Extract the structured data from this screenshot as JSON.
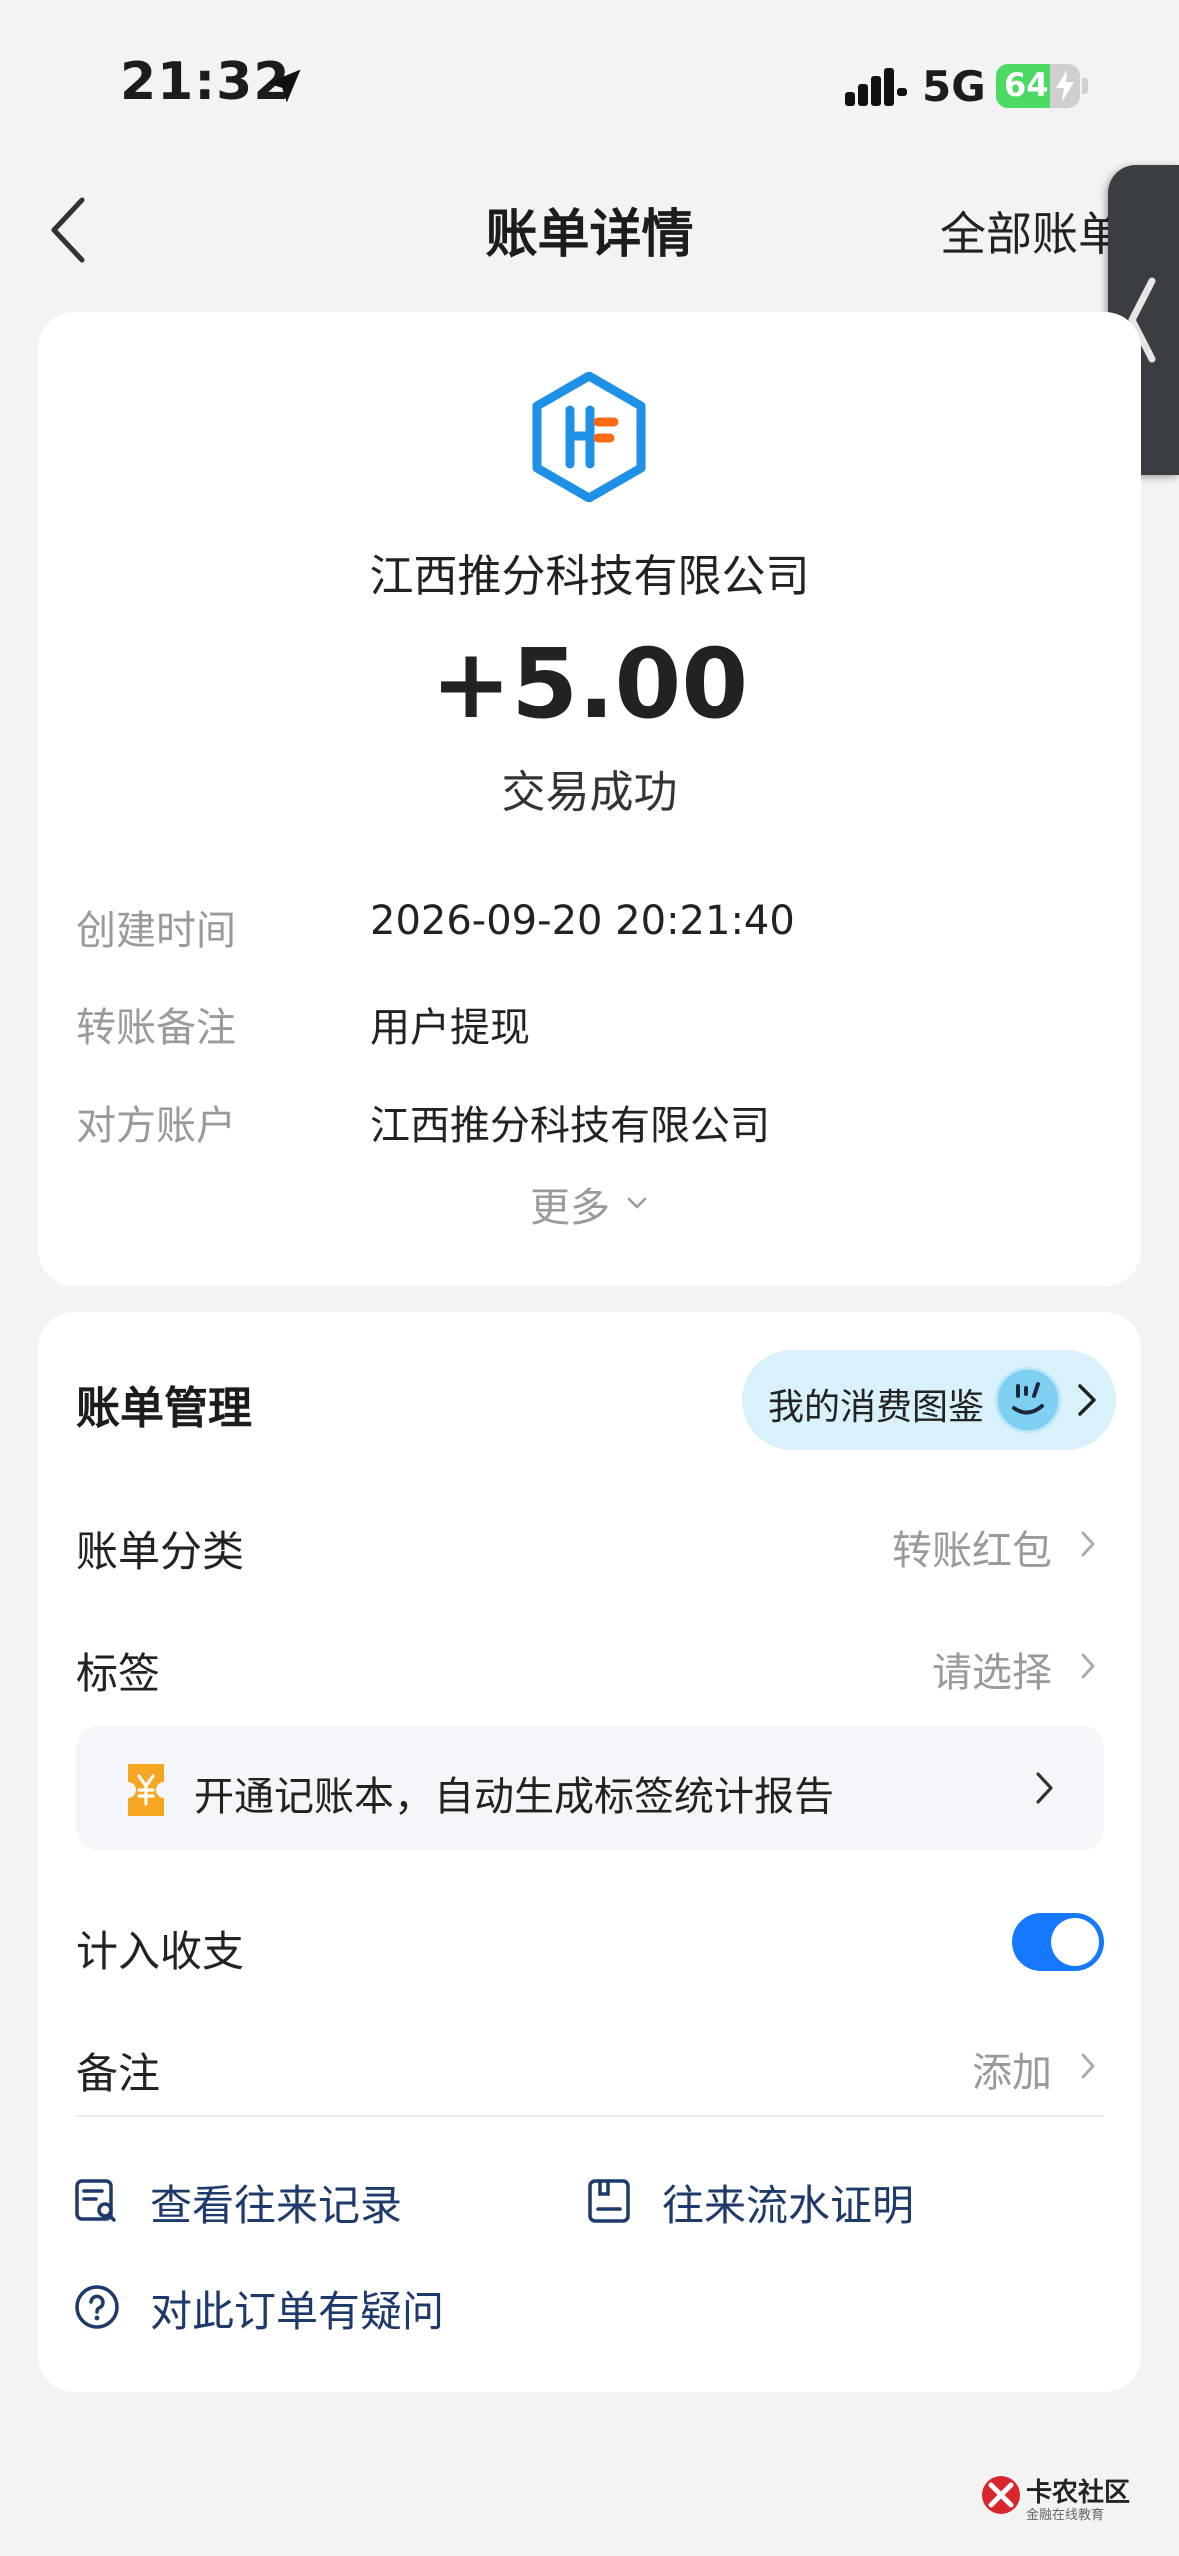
{
  "status_bar": {
    "time": "21:32",
    "network": "5G",
    "battery": "64"
  },
  "nav": {
    "title": "账单详情",
    "right": "全部账单"
  },
  "bill": {
    "merchant": "江西推分科技有限公司",
    "amount": "+5.00",
    "status": "交易成功",
    "details": [
      {
        "label": "创建时间",
        "value": "2026-09-20 20:21:40"
      },
      {
        "label": "转账备注",
        "value": "用户提现"
      },
      {
        "label": "对方账户",
        "value": "江西推分科技有限公司"
      }
    ],
    "more": "更多"
  },
  "management": {
    "title": "账单管理",
    "consume_guide": "我的消费图鉴",
    "category_label": "账单分类",
    "category_value": "转账红包",
    "tag_label": "标签",
    "tag_value": "请选择",
    "promo": "开通记账本，自动生成标签统计报告",
    "include_label": "计入收支",
    "include_enabled": true,
    "note_label": "备注",
    "note_value": "添加",
    "links": {
      "history": "查看往来记录",
      "proof": "往来流水证明",
      "question": "对此订单有疑问"
    }
  },
  "watermark": {
    "name": "卡农社区",
    "sub": "金融在线教育"
  },
  "colors": {
    "accent": "#1677ff",
    "logo_blue": "#1e90e6",
    "logo_orange": "#ff6a13",
    "link": "#1d3a6b"
  }
}
